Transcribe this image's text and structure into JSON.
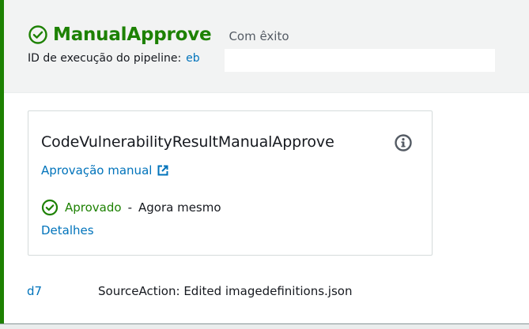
{
  "stage": {
    "name": "ManualApprove",
    "status": "Com êxito",
    "execution_label": "ID de execução do pipeline:",
    "execution_id": "eb"
  },
  "action": {
    "name": "CodeVulnerabilityResultManualApprove",
    "provider": "Aprovação manual",
    "status": "Aprovado",
    "separator": "-",
    "time": "Agora mesmo",
    "details_label": "Detalhes"
  },
  "revision": {
    "id": "d7",
    "message": "SourceAction: Edited imagedefinitions.json"
  },
  "colors": {
    "success": "#1d8102",
    "link": "#0073bb",
    "header_bg": "#f2f3f3",
    "text": "#16191f"
  },
  "icons": {
    "stage_status": "check-circle-icon",
    "info": "info-icon",
    "external": "external-link-icon",
    "action_status": "check-circle-icon"
  }
}
